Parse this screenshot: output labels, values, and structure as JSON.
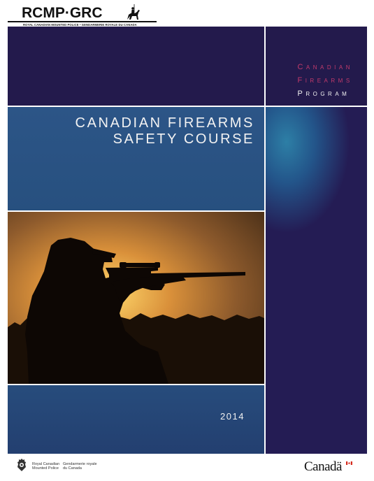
{
  "header": {
    "logo_text": "RCMP·GRC",
    "logo_subtext": "ROYAL CANADIAN MOUNTED POLICE • GENDARMERIE ROYALE DU CANADA",
    "logo_icon": "mounted-rider-icon"
  },
  "program": {
    "line1": "Canadian",
    "line2": "Firearms",
    "line3": "Program"
  },
  "course": {
    "title_line1": "CANADIAN FIREARMS",
    "title_line2": "SAFETY COURSE"
  },
  "year": "2014",
  "footer": {
    "crest_icon": "rcmp-crest-icon",
    "english_name": "Royal Canadian\nMounted Police",
    "french_name": "Gendarmerie royale\ndu Canada",
    "wordmark": "Canadä",
    "flag_icon": "canada-flag-icon"
  },
  "colors": {
    "dark_purple": "#231a4c",
    "title_blue": "#2c5587",
    "program_red": "#c23a6b"
  }
}
